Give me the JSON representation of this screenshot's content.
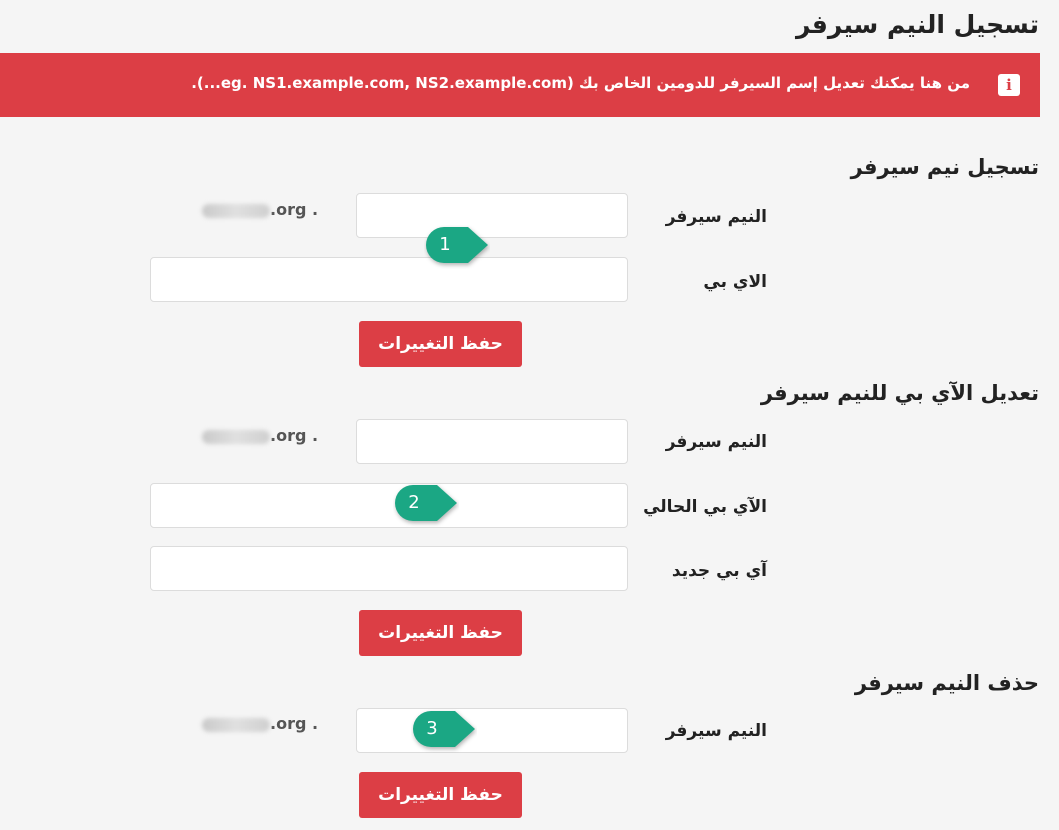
{
  "page": {
    "title": "تسجيل النيم سيرفر"
  },
  "alert": {
    "icon": "info-icon",
    "text": "من هنا يمكنك تعديل إسم السيرفر للدومين الخاص بك (eg. NS1.example.com, NS2.example.com...)."
  },
  "domain_suffix": ".org .",
  "register": {
    "title": "تسجيل نيم سيرفر",
    "nameserver_label": "النيم سيرفر",
    "ip_label": "الاي بي",
    "save_label": "حفظ التغييرات"
  },
  "modify": {
    "title": "تعديل الآي بي للنيم سيرفر",
    "nameserver_label": "النيم سيرفر",
    "current_ip_label": "الآي بي الحالي",
    "new_ip_label": "آي بي جديد",
    "save_label": "حفظ التغييرات"
  },
  "delete": {
    "title": "حذف النيم سيرفر",
    "nameserver_label": "النيم سيرفر",
    "save_label": "حفظ التغييرات"
  },
  "markers": [
    "1",
    "2",
    "3"
  ],
  "colors": {
    "accent": "#dc3e45",
    "marker": "#1ba784"
  }
}
